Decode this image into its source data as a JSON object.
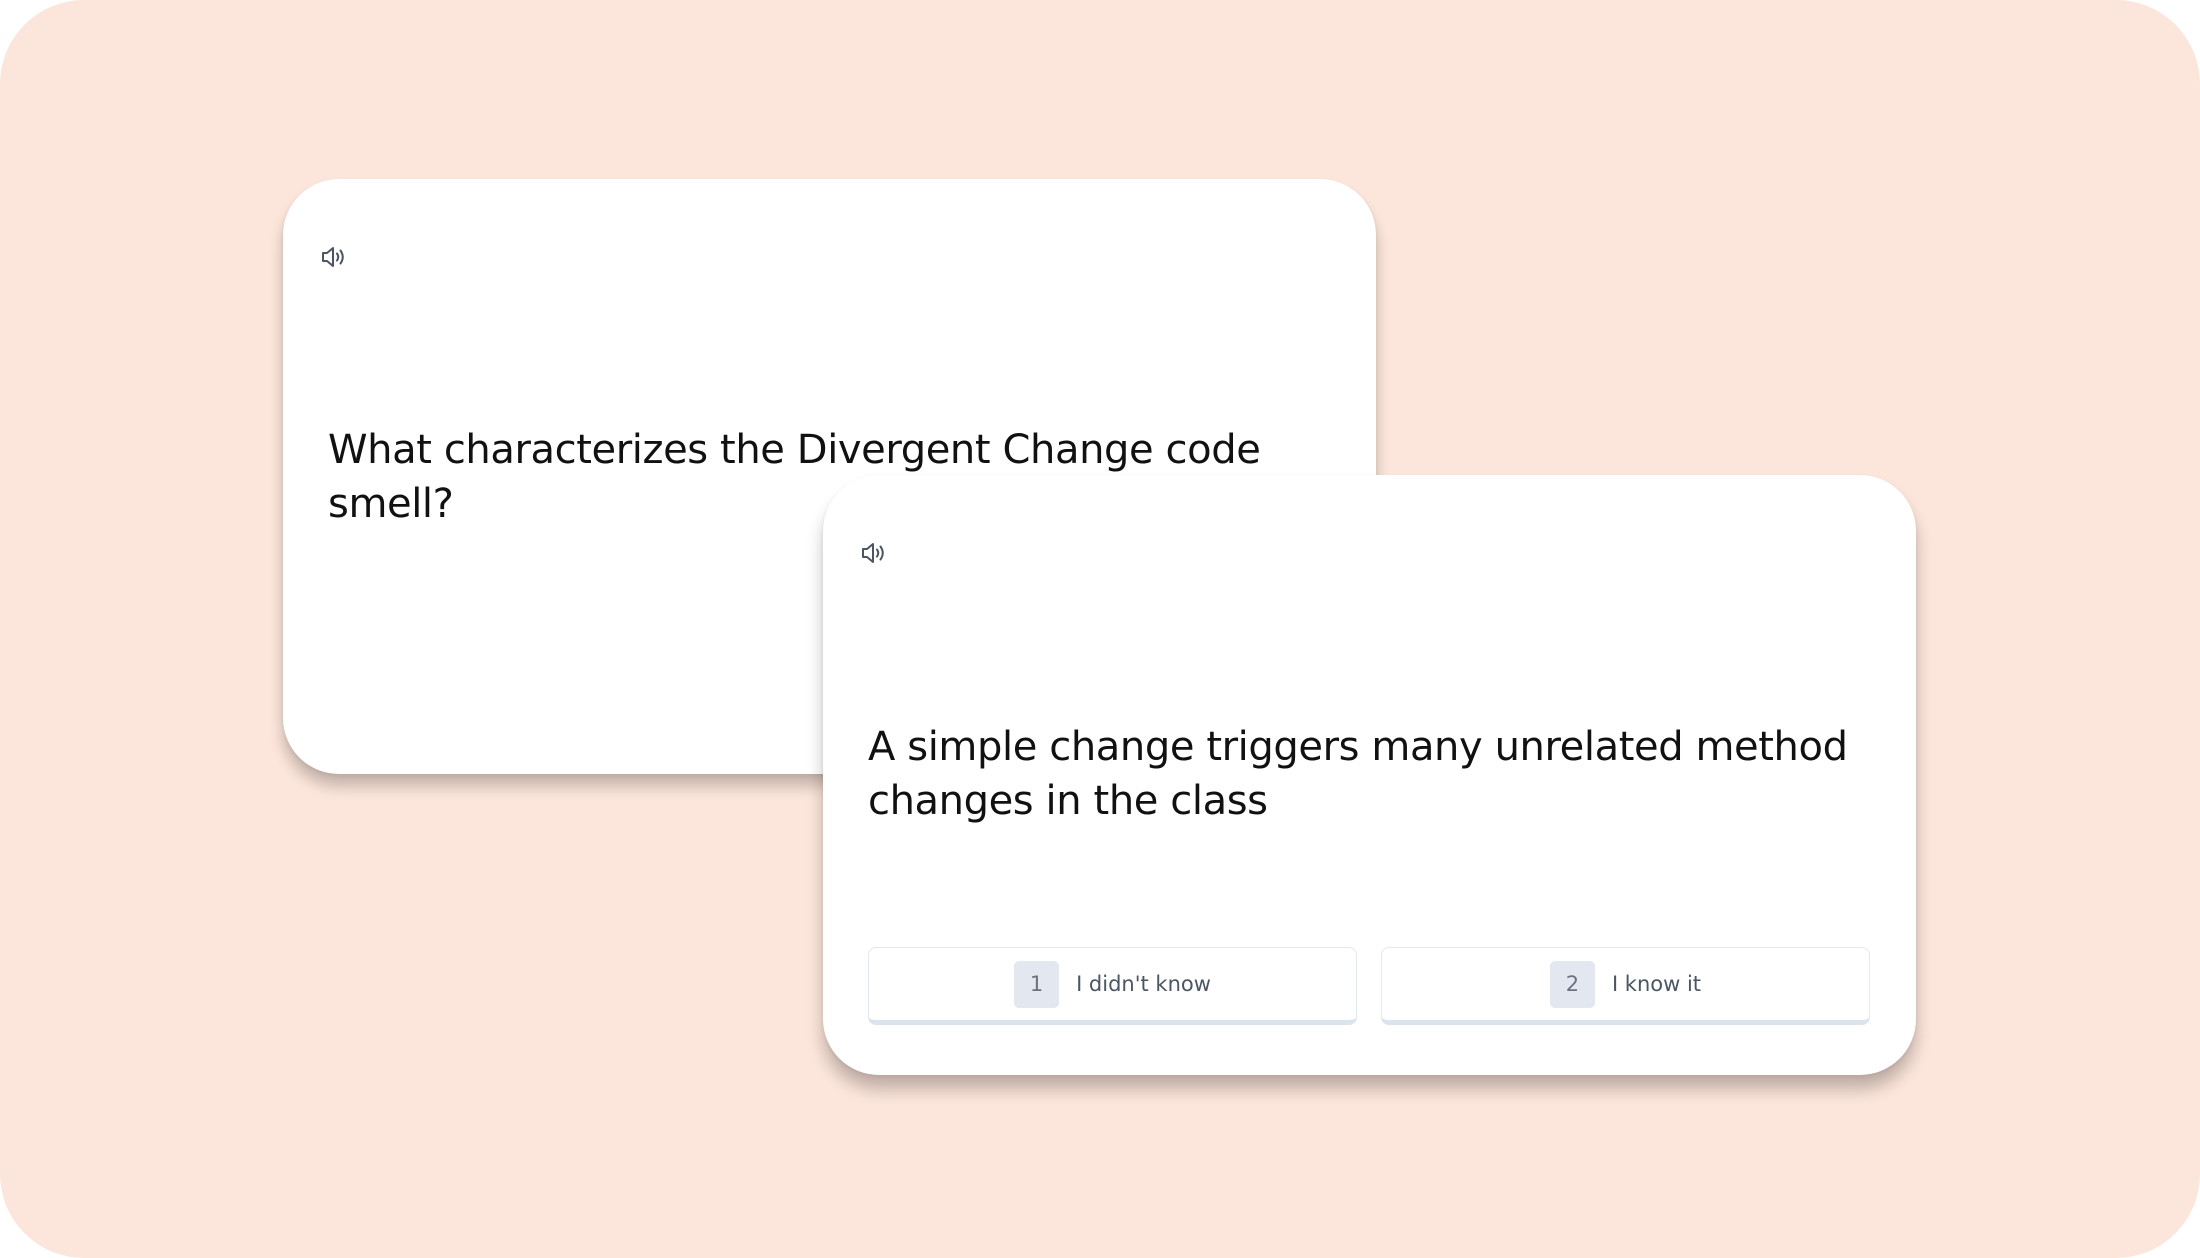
{
  "question_card": {
    "speaker_icon": "speaker-icon",
    "text": "What characterizes the Divergent Change code smell?"
  },
  "answer_card": {
    "speaker_icon": "speaker-icon",
    "text": "A simple change triggers many unrelated method changes in the class",
    "buttons": [
      {
        "key": "1",
        "label": "I didn't know"
      },
      {
        "key": "2",
        "label": "I know it"
      }
    ]
  },
  "colors": {
    "background": "#fce5da",
    "card": "#ffffff",
    "text": "#111111",
    "keycap": "#e3e8f0"
  }
}
